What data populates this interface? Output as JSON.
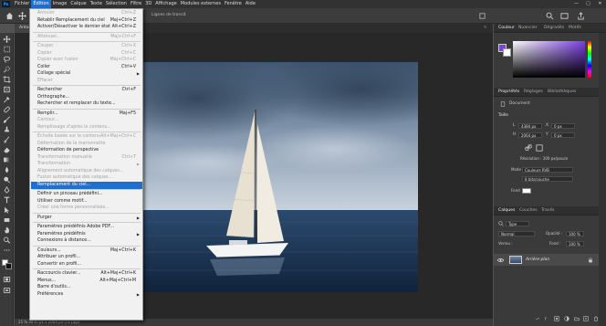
{
  "app": {
    "logo": "Ps"
  },
  "menubar": [
    "Fichier",
    "Édition",
    "Image",
    "Calque",
    "Texte",
    "Sélection",
    "Filtre",
    "3D",
    "Affichage",
    "Modules externes",
    "Fenêtre",
    "Aide"
  ],
  "active_menu_index": 1,
  "window_controls": [
    "—",
    "▢",
    "✕"
  ],
  "options_bar": {
    "text": "Lignes de transit"
  },
  "tab": {
    "title": "Anton"
  },
  "status_text": "25 %   3440 px x 2064 px (72 ppp)",
  "dropdown": [
    {
      "type": "item",
      "label": "Annuler",
      "shortcut": "Ctrl+Z",
      "disabled": true
    },
    {
      "type": "item",
      "label": "Rétablir Remplacement du ciel",
      "shortcut": "Maj+Ctrl+Z"
    },
    {
      "type": "item",
      "label": "Activer/Désactiver le dernier état",
      "shortcut": "Alt+Ctrl+Z"
    },
    {
      "type": "sep"
    },
    {
      "type": "item",
      "label": "Atténuer...",
      "shortcut": "Maj+Ctrl+F",
      "disabled": true
    },
    {
      "type": "sep"
    },
    {
      "type": "item",
      "label": "Couper",
      "shortcut": "Ctrl+X",
      "disabled": true
    },
    {
      "type": "item",
      "label": "Copier",
      "shortcut": "Ctrl+C",
      "disabled": true
    },
    {
      "type": "item",
      "label": "Copier avec fusion",
      "shortcut": "Maj+Ctrl+C",
      "disabled": true
    },
    {
      "type": "item",
      "label": "Coller",
      "shortcut": "Ctrl+V"
    },
    {
      "type": "item",
      "label": "Collage spécial",
      "submenu": true
    },
    {
      "type": "item",
      "label": "Effacer",
      "disabled": true
    },
    {
      "type": "sep"
    },
    {
      "type": "item",
      "label": "Rechercher",
      "shortcut": "Ctrl+F"
    },
    {
      "type": "item",
      "label": "Orthographe..."
    },
    {
      "type": "item",
      "label": "Rechercher et remplacer du texte..."
    },
    {
      "type": "sep"
    },
    {
      "type": "item",
      "label": "Remplir...",
      "shortcut": "Maj+F5"
    },
    {
      "type": "item",
      "label": "Contour...",
      "disabled": true
    },
    {
      "type": "item",
      "label": "Remplissage d'après le contenu...",
      "disabled": true
    },
    {
      "type": "sep"
    },
    {
      "type": "item",
      "label": "Échelle basée sur le contenu",
      "shortcut": "Alt+Maj+Ctrl+C",
      "disabled": true
    },
    {
      "type": "item",
      "label": "Déformation de la marionnette",
      "disabled": true
    },
    {
      "type": "item",
      "label": "Déformation de perspective"
    },
    {
      "type": "item",
      "label": "Transformation manuelle",
      "shortcut": "Ctrl+T",
      "disabled": true
    },
    {
      "type": "item",
      "label": "Transformation",
      "submenu": true,
      "disabled": true
    },
    {
      "type": "item",
      "label": "Alignement automatique des calques...",
      "disabled": true
    },
    {
      "type": "item",
      "label": "Fusion automatique des calques...",
      "disabled": true
    },
    {
      "type": "item",
      "label": "Remplacement du ciel...",
      "highlighted": true
    },
    {
      "type": "sep"
    },
    {
      "type": "item",
      "label": "Définir un pinceau prédéfini..."
    },
    {
      "type": "item",
      "label": "Utiliser comme motif..."
    },
    {
      "type": "item",
      "label": "Créer une forme personnalisée...",
      "disabled": true
    },
    {
      "type": "sep"
    },
    {
      "type": "item",
      "label": "Purger",
      "submenu": true
    },
    {
      "type": "sep"
    },
    {
      "type": "item",
      "label": "Paramètres prédéfinis Adobe PDF..."
    },
    {
      "type": "item",
      "label": "Paramètres prédéfinis",
      "submenu": true
    },
    {
      "type": "item",
      "label": "Connexions à distance..."
    },
    {
      "type": "sep"
    },
    {
      "type": "item",
      "label": "Couleurs...",
      "shortcut": "Maj+Ctrl+K"
    },
    {
      "type": "item",
      "label": "Attribuer un profil..."
    },
    {
      "type": "item",
      "label": "Convertir en profil..."
    },
    {
      "type": "sep"
    },
    {
      "type": "item",
      "label": "Raccourcis clavier...",
      "shortcut": "Alt+Maj+Ctrl+K"
    },
    {
      "type": "item",
      "label": "Menus...",
      "shortcut": "Alt+Maj+Ctrl+M"
    },
    {
      "type": "item",
      "label": "Barre d'outils..."
    },
    {
      "type": "item",
      "label": "Préférences",
      "submenu": true
    }
  ],
  "color_panel": {
    "tabs": [
      "Couleur",
      "Nuancier",
      "Dégradés",
      "Motifs"
    ],
    "active": 0,
    "fg": "#7b3fe4",
    "bg": "#ffffff"
  },
  "props_panel": {
    "tabs": [
      "Propriétés",
      "Réglages",
      "Bibliothèques"
    ],
    "active": 0,
    "doc_label": "Document",
    "section": "Taille",
    "width": "4384 px",
    "height": "2064 px",
    "x": "0 px",
    "y": "0 px",
    "resolution": "Résolution : 300 px/pouce",
    "mode_label": "Mode",
    "mode": "Couleurs RVB",
    "depth": "8 bits/couche",
    "fond_label": "Fond"
  },
  "layers_panel": {
    "tabs": [
      "Calques",
      "Couches",
      "Tracés"
    ],
    "active": 0,
    "kind": "Type",
    "blend": "Normal",
    "opacity_label": "Opacité :",
    "opacity": "100 %",
    "lock_label": "Verrou :",
    "fill_label": "Fond :",
    "fill": "100 %",
    "layer_name": "Arrière-plan"
  },
  "colors": {
    "menu_highlight": "#1f6fd1",
    "accent_purple": "#7b3fe4"
  }
}
